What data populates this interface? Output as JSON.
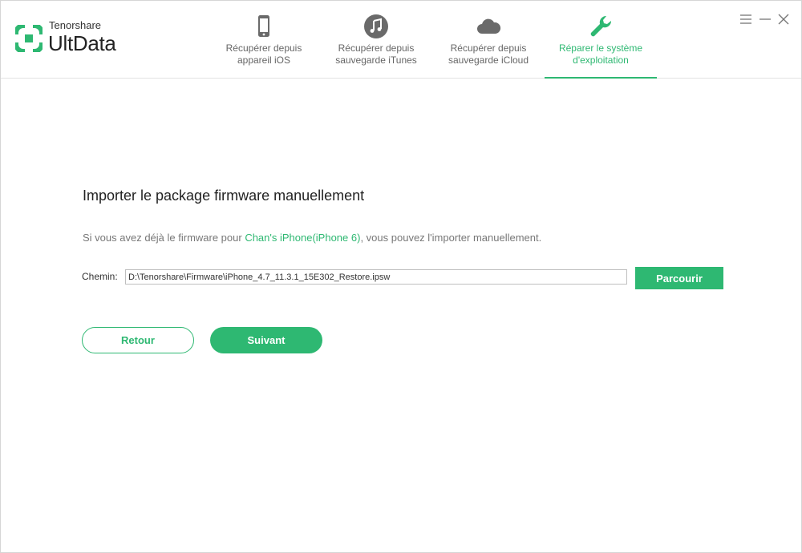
{
  "app": {
    "company": "Tenorshare",
    "product": "UltData",
    "accent_color": "#2eb872"
  },
  "tabs": [
    {
      "label": "Récupérer depuis\nappareil iOS",
      "icon": "phone-icon",
      "active": false
    },
    {
      "label": "Récupérer depuis\nsauvegarde iTunes",
      "icon": "music-note-icon",
      "active": false
    },
    {
      "label": "Récupérer depuis\nsauvegarde iCloud",
      "icon": "cloud-icon",
      "active": false
    },
    {
      "label": "Réparer le système\nd'exploitation",
      "icon": "wrench-icon",
      "active": true
    }
  ],
  "window_controls": {
    "icons": [
      "menu-icon",
      "minimize-icon",
      "close-icon"
    ]
  },
  "main": {
    "title": "Importer le package firmware manuellement",
    "description_before": "Si vous avez déjà le firmware pour ",
    "device_name": "Chan's iPhone(iPhone 6)",
    "description_after": ", vous pouvez l'importer manuellement.",
    "path_label": "Chemin:",
    "path_value": "D:\\Tenorshare\\Firmware\\iPhone_4.7_11.3.1_15E302_Restore.ipsw",
    "browse_label": "Parcourir",
    "back_label": "Retour",
    "next_label": "Suivant"
  }
}
